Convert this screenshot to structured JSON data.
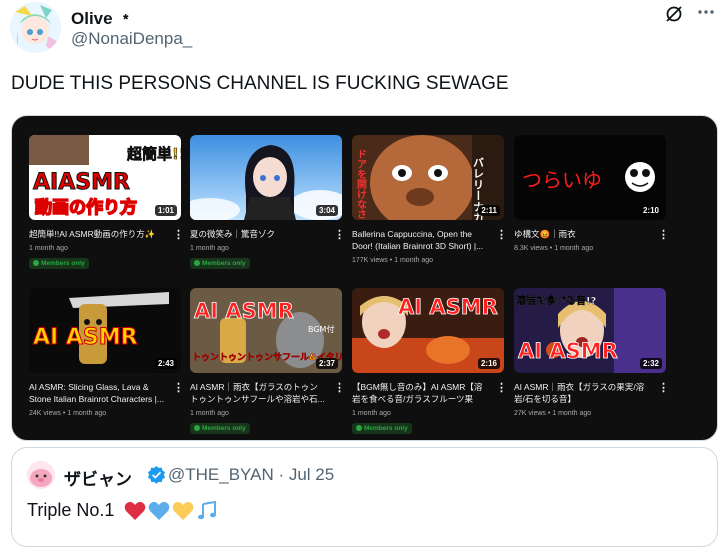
{
  "author": {
    "display_name": "Olive ﹡",
    "handle": "@NonaiDenpa_"
  },
  "header_icons": [
    "grok-icon",
    "more-icon"
  ],
  "tweet_text": "DUDE THIS PERSONS CHANNEL IS FUCKING SEWAGE",
  "videos": [
    {
      "title": "超簡単!!AI ASMR動画の作り方✨",
      "meta": "1 month ago",
      "members_only": true,
      "duration": "1:01",
      "thumb_text": "AIASMR",
      "thumb_sub": "動画の作り方",
      "thumb_tag": "超簡単!!"
    },
    {
      "title": "夏の微笑み｜驚音ゾク",
      "meta": "1 month ago",
      "members_only": true,
      "duration": "3:04"
    },
    {
      "title": "Ballerina Cappuccina, Open the Door! (Italian Brainrot 3D Short) |...",
      "meta": "177K views • 1 month ago",
      "members_only": false,
      "duration": "2:11",
      "thumb_text": "バレリーナカプチーナ",
      "thumb_sub": "ドアを開けなさい"
    },
    {
      "title": "ゆ構文😡｜雨衣",
      "meta": "8.3K views • 1 month ago",
      "members_only": false,
      "duration": "2:10",
      "thumb_text": "つらいゆ"
    },
    {
      "title": "AI ASMR: Slicing Glass, Lava & Stone Italian Brainrot Characters |...",
      "meta": "24K views • 1 month ago",
      "members_only": false,
      "duration": "2:43",
      "thumb_text": "AI ASMR"
    },
    {
      "title": "AI ASMR｜雨衣【ガラスのトゥントゥントゥンサフールや溶岩や石...",
      "meta": "1 month ago",
      "members_only": true,
      "duration": "2:37",
      "thumb_text": "AI ASMR",
      "thumb_tag": "BGM付",
      "thumb_sub": "トゥントゥントゥンサフール&イタリアンブレインロット"
    },
    {
      "title": "【BGM無し音のみ】AI ASMR【溶岩を食べる音/ガラスフルーツ果実・...",
      "meta": "1 month ago",
      "members_only": true,
      "duration": "2:16",
      "thumb_text": "AI ASMR"
    },
    {
      "title": "AI ASMR｜雨衣【ガラスの果実/溶岩/石を切る音】",
      "meta": "27K views • 1 month ago",
      "members_only": false,
      "duration": "2:32",
      "thumb_text": "AI ASMR",
      "thumb_tag": "溶岩を食べる音!?"
    }
  ],
  "members_label": "Members only",
  "kebab": "⋮",
  "quote": {
    "display_name": "ザビャン",
    "handle": "@THE_BYAN · Jul 25",
    "text": "Triple No.1",
    "emojis": [
      "red-heart",
      "blue-heart",
      "yellow-heart",
      "musical-notes"
    ]
  },
  "colors": {
    "accent_blue": "#1d9bf0",
    "members_green": "#2ba640",
    "card_bg": "#0f0f0f"
  }
}
